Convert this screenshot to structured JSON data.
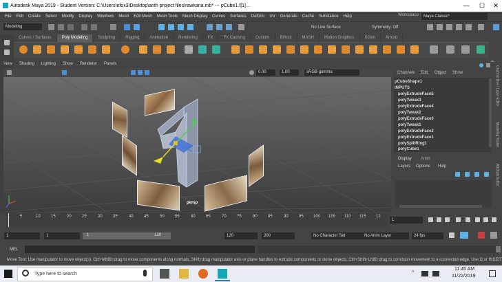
{
  "window": {
    "title": "Autodesk Maya 2019 - Student Version: C:\\Users\\efox3\\Desktop\\anth project files\\rawkana.mb*  ---  pCube1.f[1]...",
    "minimize": "—",
    "maximize": "☐",
    "close": "✕"
  },
  "menubar": [
    "File",
    "Edit",
    "Create",
    "Select",
    "Modify",
    "Display",
    "Windows",
    "Mesh",
    "Edit Mesh",
    "Mesh Tools",
    "Mesh Display",
    "Curves",
    "Surfaces",
    "Deform",
    "UV",
    "Generate",
    "Cache",
    "Substance",
    "Help"
  ],
  "workspace": {
    "label": "Workspace :",
    "value": "Maya Classic*"
  },
  "statusline": {
    "mode": "Modeling",
    "live_surface": "No Live Surface",
    "symmetry": "Symmetry: Off"
  },
  "shelf_tabs": [
    "Curves / Surfaces",
    "Poly Modeling",
    "Sculpting",
    "Rigging",
    "Animation",
    "Rendering",
    "FX",
    "FX Caching",
    "Custom",
    "Bifrost",
    "MASH",
    "Motion Graphics",
    "XGen",
    "Arnold"
  ],
  "shelf_active": "Poly Modeling",
  "viewport": {
    "menu": [
      "View",
      "Shading",
      "Lighting",
      "Show",
      "Renderer",
      "Panels"
    ],
    "val1": "0.00",
    "val2": "1.00",
    "colorspace": "sRGB gamma",
    "camera": "persp"
  },
  "channel_box": {
    "menu": [
      "Channels",
      "Edit",
      "Object",
      "Show"
    ],
    "shape": "pCubeShape1",
    "inputs_label": "INPUTS",
    "inputs": [
      "polyExtrudeFace5",
      "polyTweak3",
      "polyExtrudeFace4",
      "polyTweak2",
      "polyExtrudeFace3",
      "polyTweak1",
      "polyExtrudeFace2",
      "polyExtrudeFace1",
      "polySplitRing1",
      "polyCube1"
    ]
  },
  "layer_editor": {
    "tabs": [
      "Display",
      "Anim"
    ],
    "menu": [
      "Layers",
      "Options",
      "Help"
    ]
  },
  "side_tabs": [
    "Channel Box / Layer Editor",
    "Modeling Toolkit",
    "Attribute Editor"
  ],
  "timeline": {
    "ticks": [
      "1",
      "5",
      "10",
      "15",
      "20",
      "25",
      "30",
      "35",
      "40",
      "45",
      "50",
      "55",
      "60",
      "65",
      "70",
      "75",
      "80",
      "85",
      "90",
      "95",
      "100",
      "105",
      "110",
      "115",
      "12"
    ],
    "current_frame": "1"
  },
  "range": {
    "start": "1",
    "playback_start": "1",
    "range_start": "1",
    "range_end": "120",
    "playback_end": "120",
    "end": "200",
    "character_set": "No Character Set",
    "anim_layer": "No Anim Layer",
    "fps": "24 fps"
  },
  "command_line": {
    "lang": "MEL"
  },
  "help_line": "Move Tool: Use manipulator to move object(s). Ctrl+MMB+drag to move components along normals. Shift+drag manipulator axis or plane handles to extrude components or clone objects. Ctrl+Shift+LMB+drag to constrain movement to a connected edge. Use D or INSERT to change",
  "taskbar": {
    "search_placeholder": "Type here to search",
    "time": "11:45 AM",
    "date": "11/22/2019"
  }
}
